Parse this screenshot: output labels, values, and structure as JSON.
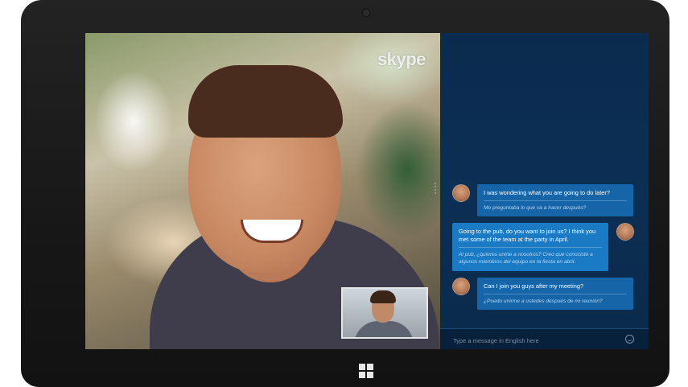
{
  "app": {
    "logo_text": "skype"
  },
  "chat": {
    "messages": [
      {
        "direction": "incoming",
        "text": "I was wondering what you are going to do later?",
        "translation": "Me preguntaba lo que va a hacer después?"
      },
      {
        "direction": "outgoing",
        "text": "Going to the pub, do you want to join us? I think you met some of the team at the party in April.",
        "translation": "Al pub, ¿quieres unirte a nosotros? Creo que conociste a algunos miembros del equipo en la fiesta en abril."
      },
      {
        "direction": "incoming",
        "text": "Can I join you guys after my meeting?",
        "translation": "¿Puedo unirme a ustedes después de mi reunión?"
      }
    ],
    "compose_placeholder": "Type a message in English here"
  },
  "colors": {
    "chat_bg": "#0c2f55",
    "incoming_bubble": "#1565a8",
    "outgoing_bubble": "#1b7ac4",
    "bezel": "#1a1a1a"
  },
  "icons": [
    "emoji-icon",
    "windows-logo-icon",
    "front-camera-icon"
  ]
}
